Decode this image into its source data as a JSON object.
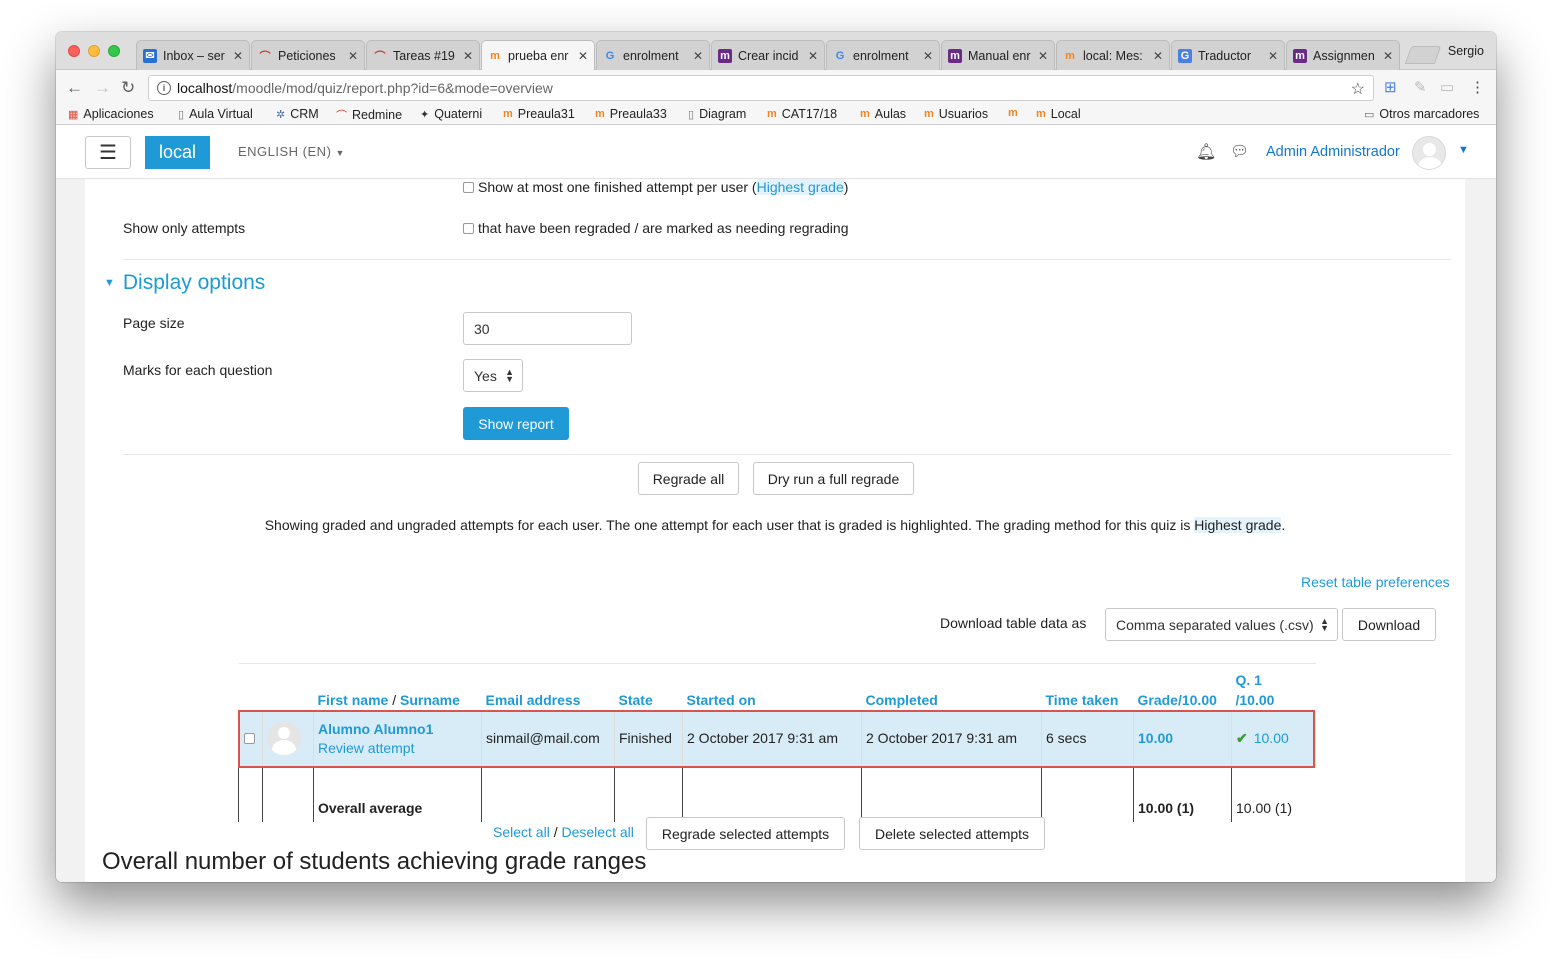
{
  "browser": {
    "tabs": [
      {
        "label": "Inbox – ser",
        "icon": "mail-icon"
      },
      {
        "label": "Peticiones",
        "icon": "redmine-icon"
      },
      {
        "label": "Tareas #19",
        "icon": "redmine-icon"
      },
      {
        "label": "prueba enr",
        "icon": "moodle-icon",
        "active": true
      },
      {
        "label": "enrolment",
        "icon": "google-icon"
      },
      {
        "label": "Crear incid",
        "icon": "moodle-m-icon"
      },
      {
        "label": "enrolment",
        "icon": "google-icon"
      },
      {
        "label": "Manual enr",
        "icon": "moodle-m-icon"
      },
      {
        "label": "local: Mes:",
        "icon": "moodle-icon"
      },
      {
        "label": "Traductor",
        "icon": "translate-icon"
      },
      {
        "label": "Assignmen",
        "icon": "moodle-m-icon"
      }
    ],
    "profile": "Sergio",
    "url_host": "localhost",
    "url_path": "/moodle/mod/quiz/report.php?id=6&mode=overview",
    "bookmarks": [
      {
        "label": "Aplicaciones",
        "icon": "apps-icon"
      },
      {
        "label": "Aula Virtual",
        "icon": "page-icon"
      },
      {
        "label": "CRM",
        "icon": "crm-icon"
      },
      {
        "label": "Redmine",
        "icon": "redmine-icon"
      },
      {
        "label": "Quaterni",
        "icon": "quaterni-icon"
      },
      {
        "label": "Preaula31",
        "icon": "moodle-icon"
      },
      {
        "label": "Preaula33",
        "icon": "moodle-icon"
      },
      {
        "label": "Diagram",
        "icon": "page-icon"
      },
      {
        "label": "CAT17/18",
        "icon": "moodle-icon"
      },
      {
        "label": "Aulas",
        "icon": "moodle-icon"
      },
      {
        "label": "Usuarios",
        "icon": "moodle-icon"
      },
      {
        "label": "",
        "icon": "moodle-icon"
      },
      {
        "label": "Local",
        "icon": "moodle-icon"
      }
    ],
    "other_bookmarks": "Otros marcadores"
  },
  "navbar": {
    "brand": "local",
    "language": "ENGLISH (EN)",
    "user": "Admin Administrador"
  },
  "filters": {
    "one_attempt_text": "Show at most one finished attempt per user (",
    "one_attempt_link": "Highest grade",
    "one_attempt_close": ")",
    "show_only_label": "Show only attempts",
    "regraded_text": "that have been regraded / are marked as needing regrading"
  },
  "display": {
    "title": "Display options",
    "page_size_label": "Page size",
    "page_size_value": "30",
    "marks_label": "Marks for each question",
    "marks_value": "Yes",
    "show_report": "Show report"
  },
  "actions": {
    "regrade_all": "Regrade all",
    "dry_run": "Dry run a full regrade"
  },
  "info": {
    "text_before": "Showing graded and ungraded attempts for each user. The one attempt for each user that is graded is highlighted. The grading method for this quiz is ",
    "grade_method": "Highest grade",
    "text_after": "."
  },
  "download": {
    "reset": "Reset table preferences",
    "label": "Download table data as",
    "format": "Comma separated values (.csv)",
    "button": "Download"
  },
  "table": {
    "col_first": "First name",
    "col_sep": " / ",
    "col_surname": "Surname",
    "col_email": "Email address",
    "col_state": "State",
    "col_started": "Started on",
    "col_completed": "Completed",
    "col_time": "Time taken",
    "col_grade": "Grade/10.00",
    "col_q1_top": "Q. 1",
    "col_q1_bottom": "/10.00",
    "row": {
      "name": "Alumno Alumno1",
      "review": "Review attempt",
      "email": "sinmail@mail.com",
      "state": "Finished",
      "started": "2 October 2017 9:31 am",
      "completed": "2 October 2017 9:31 am",
      "time": "6 secs",
      "grade": "10.00",
      "q1": "10.00"
    },
    "avg": {
      "label": "Overall average",
      "grade": "10.00 (1)",
      "q1": "10.00 (1)"
    }
  },
  "bulk": {
    "select_all": "Select all",
    "sep": " / ",
    "deselect_all": "Deselect all",
    "regrade_selected": "Regrade selected attempts",
    "delete_selected": "Delete selected attempts"
  },
  "heading": "Overall number of students achieving grade ranges"
}
